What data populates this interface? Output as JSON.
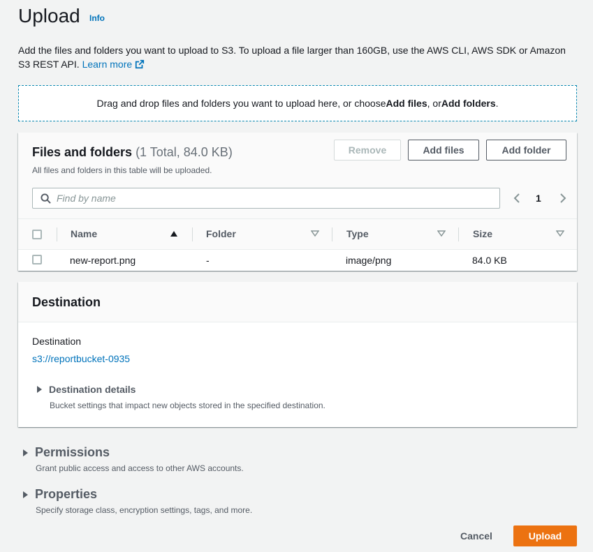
{
  "header": {
    "title": "Upload",
    "info_link": "Info",
    "description": "Add the files and folders you want to upload to S3. To upload a file larger than 160GB, use the AWS CLI, AWS SDK or Amazon S3 REST API.",
    "learn_more": "Learn more"
  },
  "dropzone": {
    "text_before": "Drag and drop files and folders you want to upload here, or choose ",
    "add_files": "Add files",
    "text_middle": ", or ",
    "add_folders": "Add folders",
    "text_after": "."
  },
  "files_panel": {
    "title": "Files and folders",
    "count": "(1 Total, 84.0 KB)",
    "subtitle": "All files and folders in this table will be uploaded.",
    "buttons": {
      "remove": "Remove",
      "add_files": "Add files",
      "add_folder": "Add folder"
    },
    "search": {
      "placeholder": "Find by name",
      "value": ""
    },
    "pagination": {
      "current_page": "1"
    },
    "columns": [
      "Name",
      "Folder",
      "Type",
      "Size"
    ],
    "rows": [
      {
        "name": "new-report.png",
        "folder": "-",
        "type": "image/png",
        "size": "84.0 KB"
      }
    ]
  },
  "destination": {
    "title": "Destination",
    "label": "Destination",
    "bucket_link": "s3://reportbucket-0935",
    "details_title": "Destination details",
    "details_subtitle": "Bucket settings that impact new objects stored in the specified destination."
  },
  "permissions": {
    "title": "Permissions",
    "subtitle": "Grant public access and access to other AWS accounts."
  },
  "properties": {
    "title": "Properties",
    "subtitle": "Specify storage class, encryption settings, tags, and more."
  },
  "footer": {
    "cancel": "Cancel",
    "upload": "Upload"
  },
  "colors": {
    "link": "#0073bb",
    "primary_button": "#ec7211",
    "dropzone_border": "#0a88b1"
  }
}
